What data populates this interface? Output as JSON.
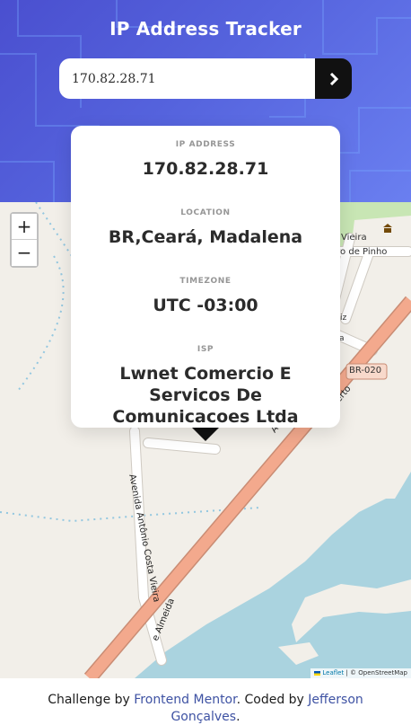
{
  "header": {
    "title": "IP Address Tracker",
    "search_value": "170.82.28.71"
  },
  "icons": {
    "submit": "chevron-right-icon",
    "marker": "location-marker-icon",
    "museum": "museum-icon"
  },
  "colors": {
    "header_gradient_start": "#4a4fcf",
    "header_gradient_end": "#6a7ff0",
    "button": "#111111",
    "road_main": "#f3a98d",
    "water": "#aad3df",
    "link": "#3e52a3"
  },
  "card": {
    "ip_label": "IP ADDRESS",
    "ip_value": "170.82.28.71",
    "location_label": "LOCATION",
    "location_value": "BR,Ceará, Madalena",
    "timezone_label": "TIMEZONE",
    "timezone_value": "UTC -03:00",
    "isp_label": "ISP",
    "isp_value": "Lwnet Comercio E Servicos De Comunicacoes Ltda"
  },
  "map": {
    "zoom_in": "+",
    "zoom_out": "−",
    "labels": {
      "road_vieira": "Vieira",
      "road_pinho": "ero de Pinho",
      "road_riz": "iz",
      "road_a": "a",
      "highway": "BR-020",
      "avenue_main": "Avenida D",
      "avenue_main_tail": "erto",
      "avenue_costa": "Avenida Antônio Costa Vieira",
      "avenue_almeida": "e Almeida"
    },
    "attribution": {
      "leaflet": "Leaflet",
      "separator": " | © ",
      "osm": "OpenStreetMap"
    }
  },
  "footer": {
    "prefix": "Challenge by ",
    "fm": "Frontend Mentor",
    "mid": ". Coded by ",
    "author_first": "Jefferson",
    "author_last": "Gonçalves",
    "suffix": "."
  }
}
